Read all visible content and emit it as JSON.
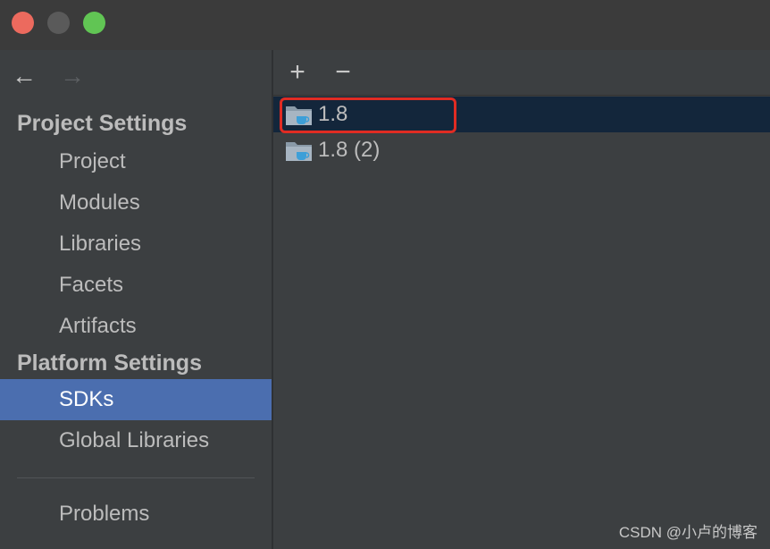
{
  "window": {
    "buttons": {
      "close": "close",
      "minimize": "minimize",
      "maximize": "maximize"
    }
  },
  "nav": {
    "back_icon": "←",
    "forward_icon": "→"
  },
  "sidebar": {
    "project_settings_title": "Project Settings",
    "project_items": [
      "Project",
      "Modules",
      "Libraries",
      "Facets",
      "Artifacts"
    ],
    "platform_settings_title": "Platform Settings",
    "platform_items": [
      "SDKs",
      "Global Libraries"
    ],
    "selected_item": "SDKs",
    "problems_label": "Problems"
  },
  "toolbar": {
    "add_icon": "+",
    "remove_icon": "−"
  },
  "sdk_list": [
    {
      "label": "1.8",
      "selected": true
    },
    {
      "label": "1.8 (2)",
      "selected": false
    }
  ],
  "watermark": "CSDN @小卢的博客",
  "colors": {
    "selection_sidebar": "#4b6eaf",
    "selection_list": "#13263b",
    "highlight_box": "#e02c23"
  }
}
